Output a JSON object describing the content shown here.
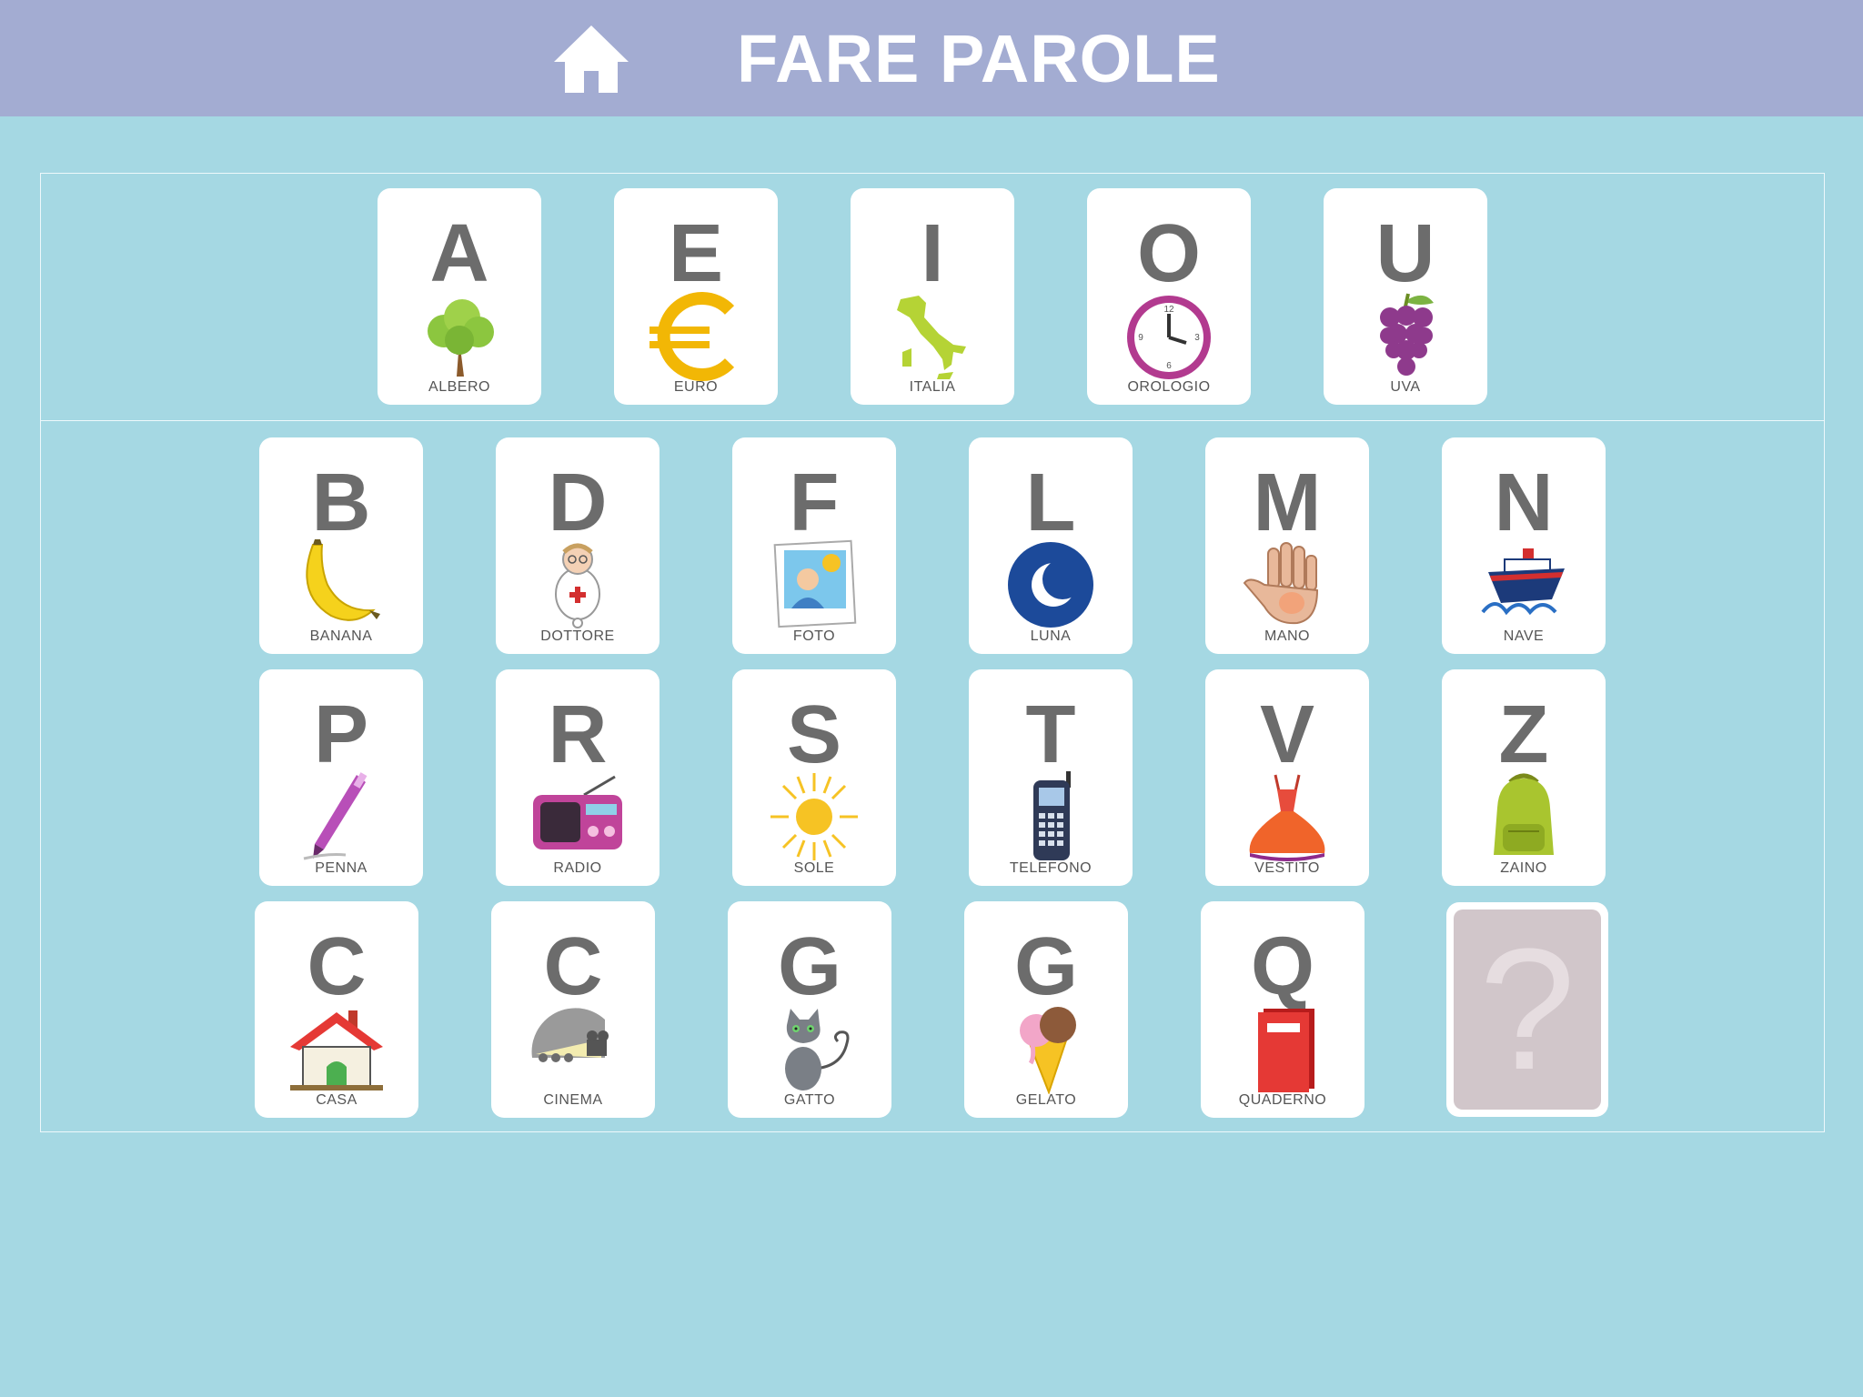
{
  "header": {
    "title": "FARE PAROLE",
    "home_icon": "home-icon"
  },
  "colors": {
    "header_bg": "#a3acd2",
    "page_bg": "#a5d8e3",
    "letter": "#6c6c6c"
  },
  "vowels": [
    {
      "letter": "A",
      "word": "ALBERO",
      "icon": "tree-icon"
    },
    {
      "letter": "E",
      "word": "EURO",
      "icon": "euro-icon"
    },
    {
      "letter": "I",
      "word": "ITALIA",
      "icon": "italy-map-icon"
    },
    {
      "letter": "O",
      "word": "OROLOGIO",
      "icon": "clock-icon"
    },
    {
      "letter": "U",
      "word": "UVA",
      "icon": "grapes-icon"
    }
  ],
  "consonants_row1": [
    {
      "letter": "B",
      "word": "BANANA",
      "icon": "banana-icon"
    },
    {
      "letter": "D",
      "word": "DOTTORE",
      "icon": "doctor-icon"
    },
    {
      "letter": "F",
      "word": "FOTO",
      "icon": "photo-icon"
    },
    {
      "letter": "L",
      "word": "LUNA",
      "icon": "moon-icon"
    },
    {
      "letter": "M",
      "word": "MANO",
      "icon": "hand-icon"
    },
    {
      "letter": "N",
      "word": "NAVE",
      "icon": "ship-icon"
    }
  ],
  "consonants_row2": [
    {
      "letter": "P",
      "word": "PENNA",
      "icon": "pen-icon"
    },
    {
      "letter": "R",
      "word": "RADIO",
      "icon": "radio-icon"
    },
    {
      "letter": "S",
      "word": "SOLE",
      "icon": "sun-icon"
    },
    {
      "letter": "T",
      "word": "TELEFONO",
      "icon": "phone-icon"
    },
    {
      "letter": "V",
      "word": "VESTITO",
      "icon": "dress-icon"
    },
    {
      "letter": "Z",
      "word": "ZAINO",
      "icon": "backpack-icon"
    }
  ],
  "consonants_row3": [
    {
      "letter": "C",
      "word": "CASA",
      "icon": "house-icon"
    },
    {
      "letter": "C",
      "word": "CINEMA",
      "icon": "cinema-icon"
    },
    {
      "letter": "G",
      "word": "GATTO",
      "icon": "cat-icon"
    },
    {
      "letter": "G",
      "word": "GELATO",
      "icon": "ice-cream-icon"
    },
    {
      "letter": "Q",
      "word": "QUADERNO",
      "icon": "notebook-icon"
    }
  ],
  "mystery_card": {
    "symbol": "?",
    "icon": "question-mark-icon"
  }
}
